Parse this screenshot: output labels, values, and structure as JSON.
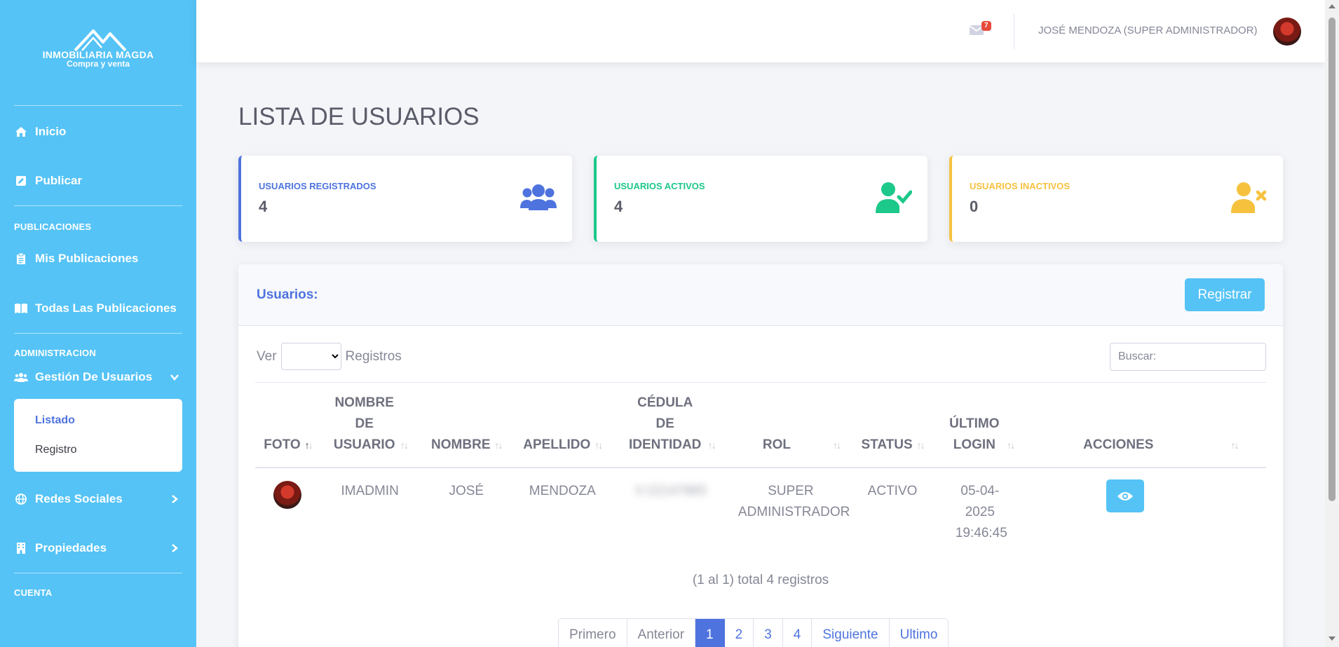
{
  "brand": {
    "name": "INMOBILIARIA MAGDA",
    "tagline": "Compra y venta"
  },
  "sidebar": {
    "items": [
      {
        "label": "Inicio",
        "icon": "home-icon"
      },
      {
        "label": "Publicar",
        "icon": "edit-icon"
      }
    ],
    "sections": {
      "publicaciones": "PUBLICACIONES",
      "administracion": "ADMINISTRACION",
      "cuenta": "CUENTA"
    },
    "publicaciones_items": [
      {
        "label": "Mis Publicaciones",
        "icon": "clipboard-icon"
      },
      {
        "label": "Todas Las Publicaciones",
        "icon": "book-icon"
      }
    ],
    "gestion": {
      "label": "Gestión De Usuarios",
      "icon": "users-icon"
    },
    "gestion_sub": [
      {
        "label": "Listado",
        "active": true
      },
      {
        "label": "Registro",
        "active": false
      }
    ],
    "more_items": [
      {
        "label": "Redes Sociales",
        "icon": "globe-icon"
      },
      {
        "label": "Propiedades",
        "icon": "building-icon"
      }
    ]
  },
  "topbar": {
    "mail_count": "7",
    "user_name": "JOSÉ MENDOZA (SUPER ADMINISTRADOR)"
  },
  "page_title": "LISTA DE USUARIOS",
  "stats": [
    {
      "label": "USUARIOS REGISTRADOS",
      "value": "4",
      "color": "#4e73df",
      "icon": "users-icon"
    },
    {
      "label": "USUARIOS ACTIVOS",
      "value": "4",
      "color": "#1cc88a",
      "icon": "user-check-icon"
    },
    {
      "label": "USUARIOS INACTIVOS",
      "value": "0",
      "color": "#f6c23e",
      "icon": "user-times-icon"
    }
  ],
  "table_card": {
    "title": "Usuarios:",
    "register_label": "Registrar",
    "show_prefix": "Ver",
    "show_suffix": "Registros",
    "search_placeholder": "Buscar:",
    "columns": [
      "FOTO",
      "NOMBRE DE USUARIO",
      "NOMBRE",
      "APELLIDO",
      "CÉDULA DE IDENTIDAD",
      "ROL",
      "STATUS",
      "ÚLTIMO LOGIN",
      "ACCIONES"
    ],
    "rows": [
      {
        "usuario": "IMADMIN",
        "nombre": "JOSÉ",
        "apellido": "MENDOZA",
        "cedula": "V-22147865",
        "rol": "SUPER ADMINISTRADOR",
        "status": "ACTIVO",
        "ultimo_login": "05-04-2025 19:46:45"
      }
    ],
    "summary": "(1 al 1) total 4 registros",
    "pagination": [
      "Primero",
      "Anterior",
      "1",
      "2",
      "3",
      "4",
      "Siguiente",
      "Ultimo"
    ],
    "active_page": "1"
  },
  "colors": {
    "sidebar": "#55c3f6",
    "primary": "#4e73df",
    "success": "#1cc88a",
    "warning": "#f6c23e",
    "badge": "#e74a3b"
  }
}
